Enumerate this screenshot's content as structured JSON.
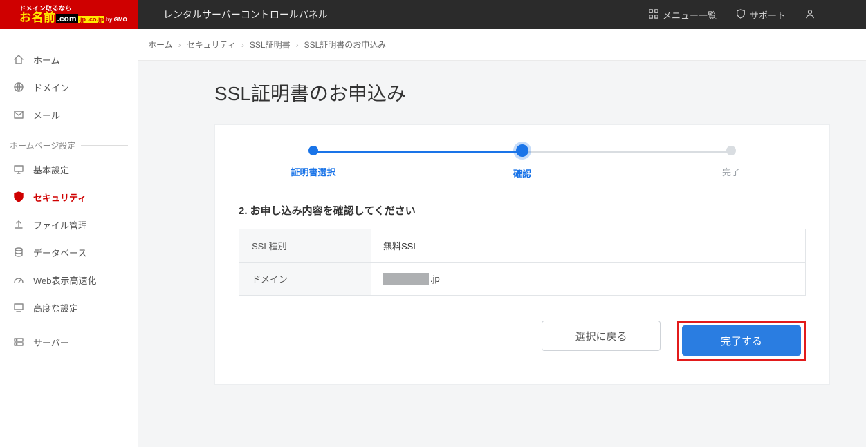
{
  "logo": {
    "tagline": "ドメイン取るなら",
    "brand_main": "お名前",
    "brand_com": ".com",
    "brand_dot": ".jp .co.jp",
    "brand_gmo": "by GMO"
  },
  "header": {
    "app_title": "レンタルサーバーコントロールパネル",
    "menu_label": "メニュー一覧",
    "support_label": "サポート"
  },
  "sidebar": {
    "items": [
      {
        "label": "ホーム"
      },
      {
        "label": "ドメイン"
      },
      {
        "label": "メール"
      }
    ],
    "group_title": "ホームページ設定",
    "settings_items": [
      {
        "label": "基本設定"
      },
      {
        "label": "セキュリティ"
      },
      {
        "label": "ファイル管理"
      },
      {
        "label": "データベース"
      },
      {
        "label": "Web表示高速化"
      },
      {
        "label": "高度な設定"
      }
    ],
    "bottom_items": [
      {
        "label": "サーバー"
      }
    ]
  },
  "breadcrumb": {
    "items": [
      "ホーム",
      "セキュリティ",
      "SSL証明書",
      "SSL証明書のお申込み"
    ]
  },
  "page": {
    "title": "SSL証明書のお申込み"
  },
  "stepper": {
    "steps": [
      {
        "label": "証明書選択"
      },
      {
        "label": "確認"
      },
      {
        "label": "完了"
      }
    ],
    "active_index": 1
  },
  "section": {
    "title": "2. お申し込み内容を確認してください"
  },
  "details": {
    "rows": [
      {
        "key": "SSL種別",
        "value": "無料SSL"
      },
      {
        "key": "ドメイン",
        "value": ".jp",
        "value_has_redaction": true
      }
    ]
  },
  "buttons": {
    "back": "選択に戻る",
    "submit": "完了する"
  }
}
